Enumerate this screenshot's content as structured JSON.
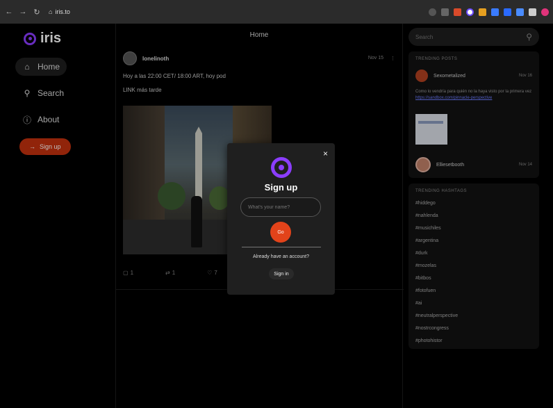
{
  "browser": {
    "url": "iris.to",
    "back": "←",
    "forward": "→",
    "reload": "↻",
    "colors": [
      "#d94a2a",
      "#ffffff",
      "#e6a020",
      "#3a7bff",
      "#2a6aff",
      "#dddddd",
      "#4a8cff",
      "#cccccc",
      "#e0337a"
    ]
  },
  "sidebar": {
    "logo_text": "iris",
    "items": [
      {
        "label": "Home",
        "icon": "home-icon"
      },
      {
        "label": "Search",
        "icon": "search-icon"
      },
      {
        "label": "About",
        "icon": "info-icon"
      }
    ],
    "signup_label": "Sign up"
  },
  "feed": {
    "title": "Home",
    "post": {
      "author": "lonelinoth",
      "date": "Nov 15",
      "more": "⋮",
      "text": "Hoy a las 22:00 CET/ 18:00 ART, hoy pod",
      "text2": "LINK más tarde",
      "actions": [
        {
          "icon": "reply-icon",
          "count": "1"
        },
        {
          "icon": "repost-icon",
          "count": "1"
        },
        {
          "icon": "like-icon",
          "count": "7"
        }
      ]
    }
  },
  "right": {
    "search_placeholder": "Search",
    "trending_posts_title": "TRENDING POSTS",
    "trending_post": {
      "name": "Sexometalized",
      "date": "Nov 16",
      "body": "Como lo vendría para quién no la haya visto por la primera vez",
      "link": "https://sandbox.com/pinnacle-perspective",
      "name2": "Elliesetbooth",
      "date2": "Nov 14"
    },
    "trending_hashtags_title": "TRENDING HASHTAGS",
    "hashtags": [
      "#hiddego",
      "#nahlenda",
      "#musichiles",
      "#argentina",
      "#durk",
      "#mozelas",
      "#bitbos",
      "#fotofuen",
      "#ai",
      "#neutralperspective",
      "#nostrcongress",
      "#photohistor"
    ]
  },
  "modal": {
    "close": "×",
    "title": "Sign up",
    "name_placeholder": "What's your name?",
    "go_label": "Go",
    "have_account": "Already have an account?",
    "signin_label": "Sign in"
  }
}
